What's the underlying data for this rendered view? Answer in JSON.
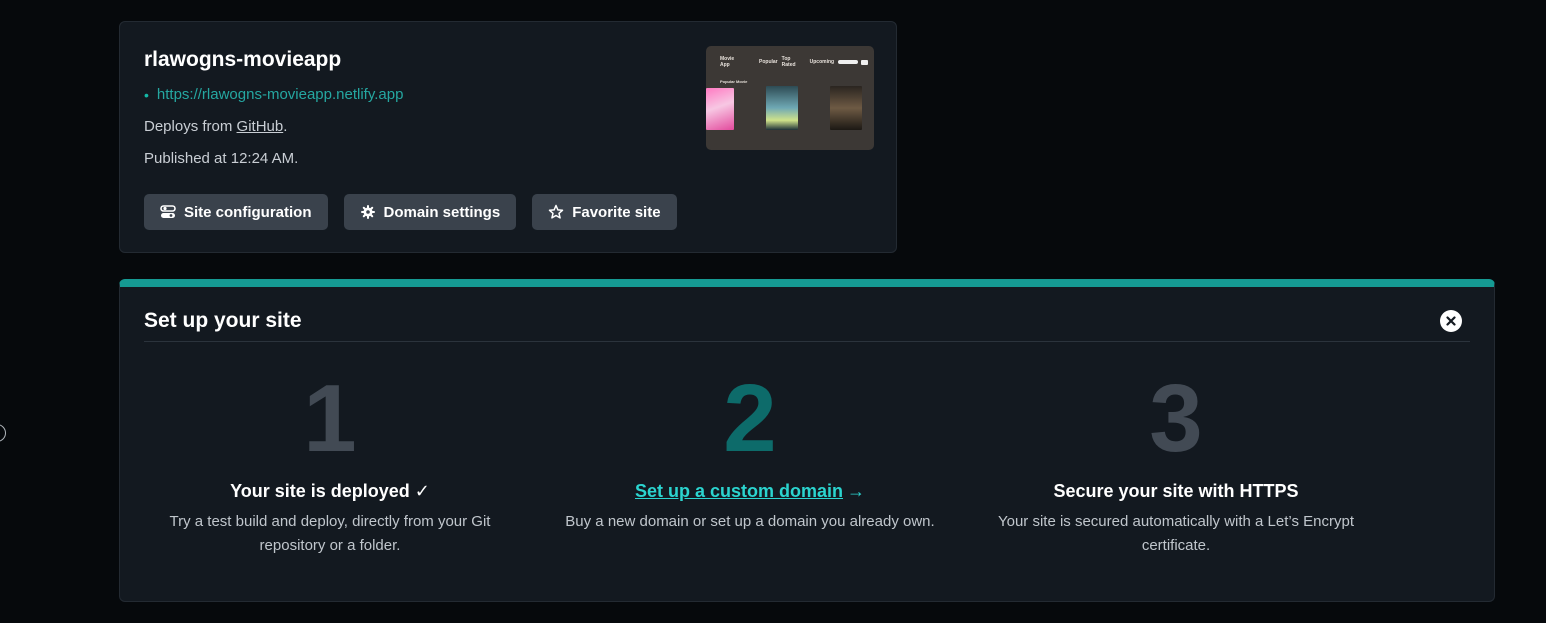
{
  "site": {
    "name": "rlawogns-movieapp",
    "url": "https://rlawogns-movieapp.netlify.app",
    "deploy_prefix": "Deploys from ",
    "deploy_source": "GitHub",
    "deploy_suffix": ".",
    "published": "Published at 12:24 AM.",
    "actions": [
      {
        "label": "Site configuration",
        "icon": "toggle-icon"
      },
      {
        "label": "Domain settings",
        "icon": "gear-icon"
      },
      {
        "label": "Favorite site",
        "icon": "star-icon"
      }
    ],
    "preview": {
      "brand": "Movie App",
      "nav": [
        "Popular",
        "Top Rated",
        "Upcoming"
      ],
      "section": "Popular Movie"
    }
  },
  "setup": {
    "title": "Set up your site",
    "steps": [
      {
        "number": "1",
        "title": "Your site is deployed ✓",
        "description": "Try a test build and deploy, directly from your Git repository or a folder."
      },
      {
        "number": "2",
        "title": "Set up a custom domain",
        "arrow": "→",
        "description": "Buy a new domain or set up a domain you already own."
      },
      {
        "number": "3",
        "title": "Secure your site with HTTPS",
        "description": "Your site is secured automatically with a Let’s Encrypt certificate."
      }
    ]
  },
  "colors": {
    "background": "#06090c",
    "card": "#131920",
    "accent": "#159a93",
    "link": "#2bd4cf",
    "button": "#3a424c"
  }
}
